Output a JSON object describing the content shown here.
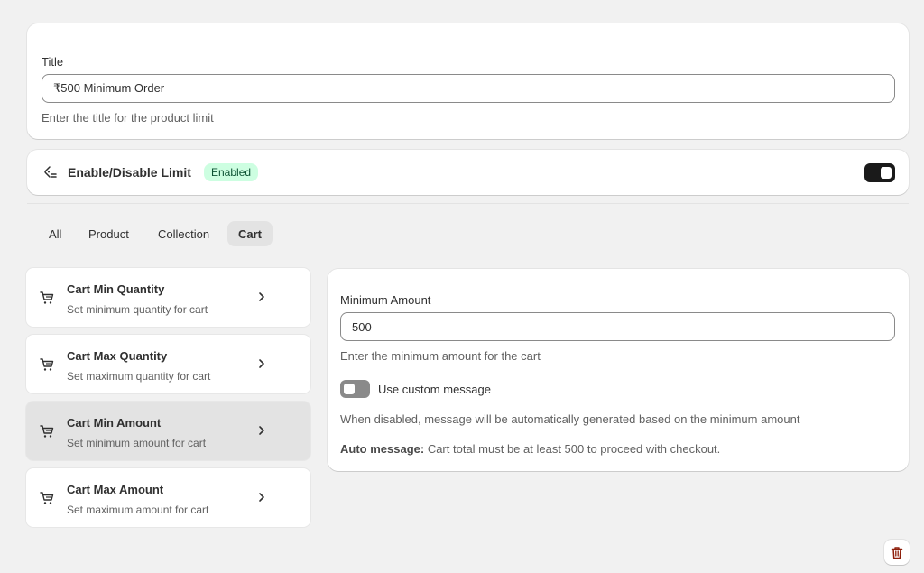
{
  "title_section": {
    "label": "Title",
    "value": "₹500 Minimum Order",
    "help": "Enter the title for the product limit"
  },
  "enable_section": {
    "icon": "tag-list-icon",
    "title": "Enable/Disable Limit",
    "badge": "Enabled",
    "toggle_on": true
  },
  "tabs": [
    {
      "label": "All",
      "active": false
    },
    {
      "label": "Product",
      "active": false
    },
    {
      "label": "Collection",
      "active": false
    },
    {
      "label": "Cart",
      "active": true
    }
  ],
  "limit_items": [
    {
      "title": "Cart Min Quantity",
      "subtitle": "Set minimum quantity for cart",
      "selected": false
    },
    {
      "title": "Cart Max Quantity",
      "subtitle": "Set maximum quantity for cart",
      "selected": false
    },
    {
      "title": "Cart Min Amount",
      "subtitle": "Set minimum amount for cart",
      "selected": true
    },
    {
      "title": "Cart Max Amount",
      "subtitle": "Set maximum amount for cart",
      "selected": false
    }
  ],
  "detail": {
    "label": "Minimum Amount",
    "value": "500",
    "help": "Enter the minimum amount for the cart",
    "custom_toggle_label": "Use custom message",
    "custom_toggle_on": false,
    "disabled_note": "When disabled, message will be automatically generated based on the minimum amount",
    "auto_label": "Auto message:",
    "auto_text": " Cart total must be at least 500 to proceed with checkout."
  },
  "colors": {
    "badge_bg": "#cdfee1",
    "badge_text": "#0c5132",
    "delete_icon": "#8e1f0b"
  }
}
